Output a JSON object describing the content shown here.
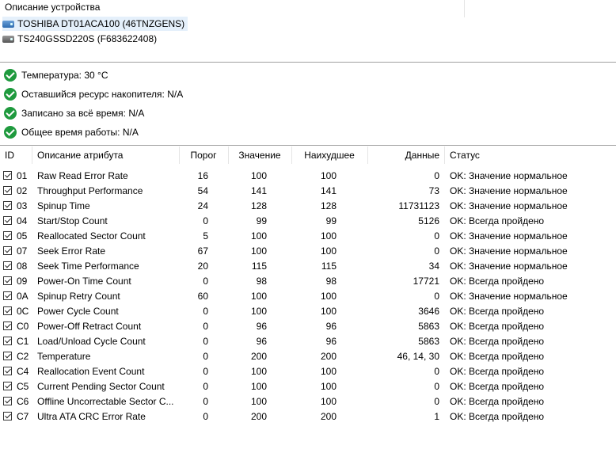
{
  "device_panel": {
    "header": "Описание устройства",
    "devices": [
      {
        "label": "TOSHIBA DT01ACA100 (46TNZGENS)",
        "icon": "hdd-icon"
      },
      {
        "label": "TS240GSSD220S (F683622408)",
        "icon": "ssd-icon"
      }
    ]
  },
  "summary": [
    {
      "label": "Температура: 30 °C"
    },
    {
      "label": "Оставшийся ресурс накопителя: N/A"
    },
    {
      "label": "Записано за всё время: N/A"
    },
    {
      "label": "Общее время работы: N/A"
    }
  ],
  "table": {
    "columns": {
      "id": "ID",
      "desc": "Описание атрибута",
      "thr": "Порог",
      "val": "Значение",
      "worst": "Наихудшее",
      "data": "Данные",
      "status": "Статус"
    },
    "rows": [
      {
        "id": "01",
        "desc": "Raw Read Error Rate",
        "thr": "16",
        "val": "100",
        "worst": "100",
        "data": "0",
        "status": "OK: Значение нормальное"
      },
      {
        "id": "02",
        "desc": "Throughput Performance",
        "thr": "54",
        "val": "141",
        "worst": "141",
        "data": "73",
        "status": "OK: Значение нормальное"
      },
      {
        "id": "03",
        "desc": "Spinup Time",
        "thr": "24",
        "val": "128",
        "worst": "128",
        "data": "11731123",
        "status": "OK: Значение нормальное"
      },
      {
        "id": "04",
        "desc": "Start/Stop Count",
        "thr": "0",
        "val": "99",
        "worst": "99",
        "data": "5126",
        "status": "OK: Всегда пройдено"
      },
      {
        "id": "05",
        "desc": "Reallocated Sector Count",
        "thr": "5",
        "val": "100",
        "worst": "100",
        "data": "0",
        "status": "OK: Значение нормальное"
      },
      {
        "id": "07",
        "desc": "Seek Error Rate",
        "thr": "67",
        "val": "100",
        "worst": "100",
        "data": "0",
        "status": "OK: Значение нормальное"
      },
      {
        "id": "08",
        "desc": "Seek Time Performance",
        "thr": "20",
        "val": "115",
        "worst": "115",
        "data": "34",
        "status": "OK: Значение нормальное"
      },
      {
        "id": "09",
        "desc": "Power-On Time Count",
        "thr": "0",
        "val": "98",
        "worst": "98",
        "data": "17721",
        "status": "OK: Всегда пройдено"
      },
      {
        "id": "0A",
        "desc": "Spinup Retry Count",
        "thr": "60",
        "val": "100",
        "worst": "100",
        "data": "0",
        "status": "OK: Значение нормальное"
      },
      {
        "id": "0C",
        "desc": "Power Cycle Count",
        "thr": "0",
        "val": "100",
        "worst": "100",
        "data": "3646",
        "status": "OK: Всегда пройдено"
      },
      {
        "id": "C0",
        "desc": "Power-Off Retract Count",
        "thr": "0",
        "val": "96",
        "worst": "96",
        "data": "5863",
        "status": "OK: Всегда пройдено"
      },
      {
        "id": "C1",
        "desc": "Load/Unload Cycle Count",
        "thr": "0",
        "val": "96",
        "worst": "96",
        "data": "5863",
        "status": "OK: Всегда пройдено"
      },
      {
        "id": "C2",
        "desc": "Temperature",
        "thr": "0",
        "val": "200",
        "worst": "200",
        "data": "46, 14, 30",
        "status": "OK: Всегда пройдено"
      },
      {
        "id": "C4",
        "desc": "Reallocation Event Count",
        "thr": "0",
        "val": "100",
        "worst": "100",
        "data": "0",
        "status": "OK: Всегда пройдено"
      },
      {
        "id": "C5",
        "desc": "Current Pending Sector Count",
        "thr": "0",
        "val": "100",
        "worst": "100",
        "data": "0",
        "status": "OK: Всегда пройдено"
      },
      {
        "id": "C6",
        "desc": "Offline Uncorrectable Sector C...",
        "thr": "0",
        "val": "100",
        "worst": "100",
        "data": "0",
        "status": "OK: Всегда пройдено"
      },
      {
        "id": "C7",
        "desc": "Ultra ATA CRC Error Rate",
        "thr": "0",
        "val": "200",
        "worst": "200",
        "data": "1",
        "status": "OK: Всегда пройдено"
      }
    ]
  }
}
